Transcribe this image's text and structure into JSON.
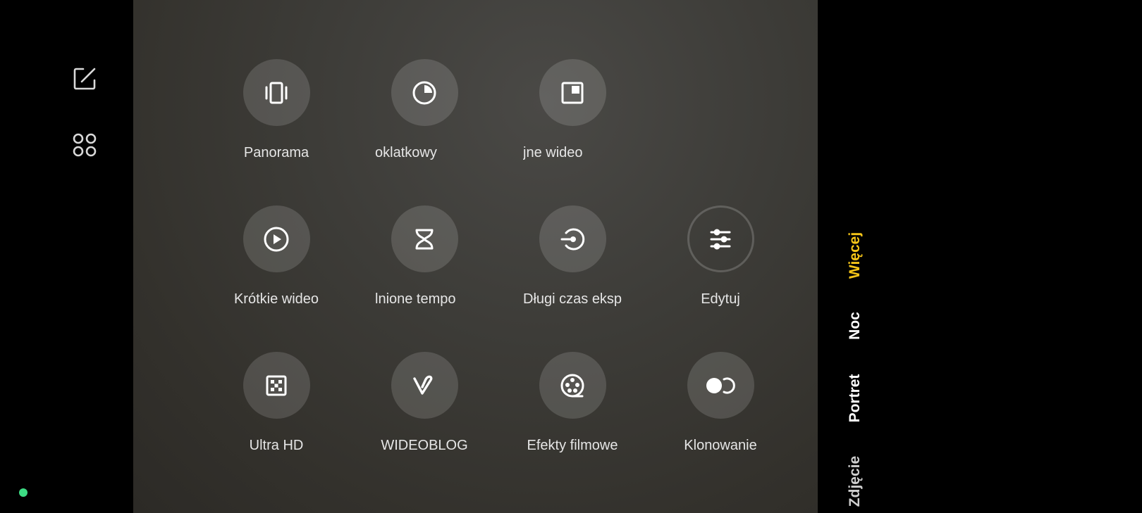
{
  "left_rail": {
    "edit_icon": "edit-square-icon",
    "grid_icon": "four-dots-grid-icon",
    "status_color": "#3ddc84"
  },
  "modes": [
    {
      "label": "Panorama",
      "icon": "panorama-icon"
    },
    {
      "label": "oklatkowy",
      "icon": "stopwatch-icon"
    },
    {
      "label": "jne wideo",
      "icon": "pip-icon"
    },
    {
      "label": "Krótkie wideo",
      "icon": "play-circle-icon"
    },
    {
      "label": "lnione tempo",
      "icon": "hourglass-icon"
    },
    {
      "label": "Długi czas eksp",
      "icon": "exposure-icon"
    },
    {
      "label": "Edytuj",
      "icon": "sliders-icon"
    },
    {
      "label": "Ultra HD",
      "icon": "ultra-hd-icon"
    },
    {
      "label": "WIDEOBLOG",
      "icon": "vlog-icon"
    },
    {
      "label": "Efekty filmowe",
      "icon": "film-reel-icon"
    },
    {
      "label": "Klonowanie",
      "icon": "clone-icon"
    }
  ],
  "mode_tabs": {
    "more": "Więcej",
    "night": "Noc",
    "portrait": "Portret",
    "photo": "Zdjęcie"
  },
  "colors": {
    "active_tab": "#f5c518",
    "text": "#e6e6e6"
  }
}
